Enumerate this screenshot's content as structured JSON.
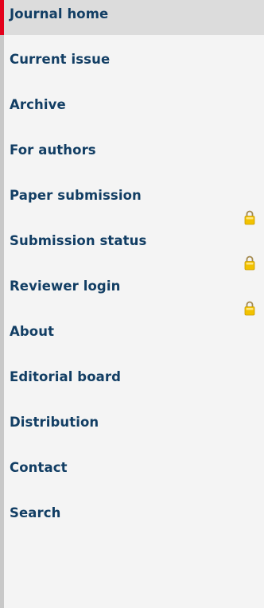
{
  "nav": {
    "items": [
      {
        "label": "Journal home",
        "active": true,
        "locked": false
      },
      {
        "label": "Current issue",
        "active": false,
        "locked": false
      },
      {
        "label": "Archive",
        "active": false,
        "locked": false
      },
      {
        "label": "For authors",
        "active": false,
        "locked": false
      },
      {
        "label": "Paper submission",
        "active": false,
        "locked": true
      },
      {
        "label": "Submission status",
        "active": false,
        "locked": true
      },
      {
        "label": "Reviewer login",
        "active": false,
        "locked": true
      },
      {
        "label": "About",
        "active": false,
        "locked": false
      },
      {
        "label": "Editorial board",
        "active": false,
        "locked": false
      },
      {
        "label": "Distribution",
        "active": false,
        "locked": false
      },
      {
        "label": "Contact",
        "active": false,
        "locked": false
      },
      {
        "label": "Search",
        "active": false,
        "locked": false
      }
    ]
  },
  "colors": {
    "active_marker": "#e3001b",
    "link_text": "#123e64",
    "active_bg": "#dcdcdc",
    "bg": "#f4f4f4",
    "lock": "#e8b800"
  }
}
